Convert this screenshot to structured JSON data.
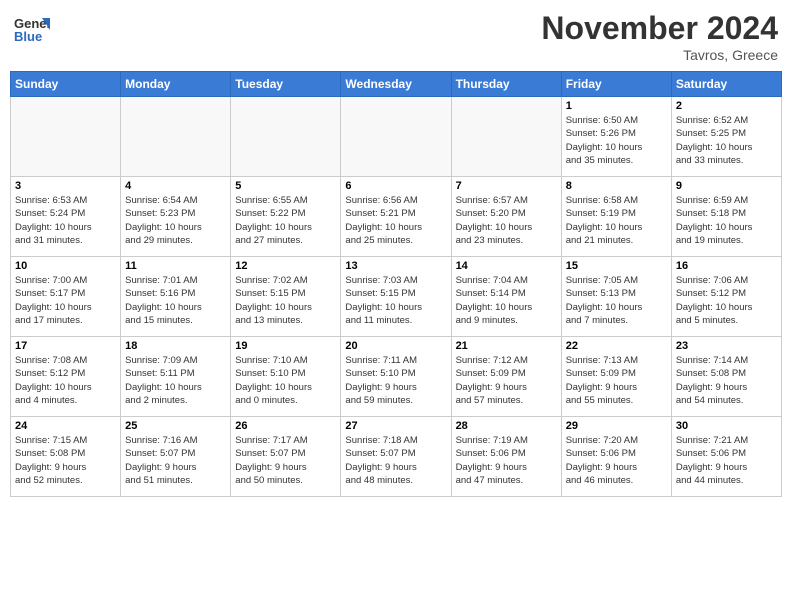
{
  "header": {
    "logo_general": "General",
    "logo_blue": "Blue",
    "month_title": "November 2024",
    "location": "Tavros, Greece"
  },
  "days_of_week": [
    "Sunday",
    "Monday",
    "Tuesday",
    "Wednesday",
    "Thursday",
    "Friday",
    "Saturday"
  ],
  "weeks": [
    [
      {
        "day": "",
        "info": ""
      },
      {
        "day": "",
        "info": ""
      },
      {
        "day": "",
        "info": ""
      },
      {
        "day": "",
        "info": ""
      },
      {
        "day": "",
        "info": ""
      },
      {
        "day": "1",
        "info": "Sunrise: 6:50 AM\nSunset: 5:26 PM\nDaylight: 10 hours\nand 35 minutes."
      },
      {
        "day": "2",
        "info": "Sunrise: 6:52 AM\nSunset: 5:25 PM\nDaylight: 10 hours\nand 33 minutes."
      }
    ],
    [
      {
        "day": "3",
        "info": "Sunrise: 6:53 AM\nSunset: 5:24 PM\nDaylight: 10 hours\nand 31 minutes."
      },
      {
        "day": "4",
        "info": "Sunrise: 6:54 AM\nSunset: 5:23 PM\nDaylight: 10 hours\nand 29 minutes."
      },
      {
        "day": "5",
        "info": "Sunrise: 6:55 AM\nSunset: 5:22 PM\nDaylight: 10 hours\nand 27 minutes."
      },
      {
        "day": "6",
        "info": "Sunrise: 6:56 AM\nSunset: 5:21 PM\nDaylight: 10 hours\nand 25 minutes."
      },
      {
        "day": "7",
        "info": "Sunrise: 6:57 AM\nSunset: 5:20 PM\nDaylight: 10 hours\nand 23 minutes."
      },
      {
        "day": "8",
        "info": "Sunrise: 6:58 AM\nSunset: 5:19 PM\nDaylight: 10 hours\nand 21 minutes."
      },
      {
        "day": "9",
        "info": "Sunrise: 6:59 AM\nSunset: 5:18 PM\nDaylight: 10 hours\nand 19 minutes."
      }
    ],
    [
      {
        "day": "10",
        "info": "Sunrise: 7:00 AM\nSunset: 5:17 PM\nDaylight: 10 hours\nand 17 minutes."
      },
      {
        "day": "11",
        "info": "Sunrise: 7:01 AM\nSunset: 5:16 PM\nDaylight: 10 hours\nand 15 minutes."
      },
      {
        "day": "12",
        "info": "Sunrise: 7:02 AM\nSunset: 5:15 PM\nDaylight: 10 hours\nand 13 minutes."
      },
      {
        "day": "13",
        "info": "Sunrise: 7:03 AM\nSunset: 5:15 PM\nDaylight: 10 hours\nand 11 minutes."
      },
      {
        "day": "14",
        "info": "Sunrise: 7:04 AM\nSunset: 5:14 PM\nDaylight: 10 hours\nand 9 minutes."
      },
      {
        "day": "15",
        "info": "Sunrise: 7:05 AM\nSunset: 5:13 PM\nDaylight: 10 hours\nand 7 minutes."
      },
      {
        "day": "16",
        "info": "Sunrise: 7:06 AM\nSunset: 5:12 PM\nDaylight: 10 hours\nand 5 minutes."
      }
    ],
    [
      {
        "day": "17",
        "info": "Sunrise: 7:08 AM\nSunset: 5:12 PM\nDaylight: 10 hours\nand 4 minutes."
      },
      {
        "day": "18",
        "info": "Sunrise: 7:09 AM\nSunset: 5:11 PM\nDaylight: 10 hours\nand 2 minutes."
      },
      {
        "day": "19",
        "info": "Sunrise: 7:10 AM\nSunset: 5:10 PM\nDaylight: 10 hours\nand 0 minutes."
      },
      {
        "day": "20",
        "info": "Sunrise: 7:11 AM\nSunset: 5:10 PM\nDaylight: 9 hours\nand 59 minutes."
      },
      {
        "day": "21",
        "info": "Sunrise: 7:12 AM\nSunset: 5:09 PM\nDaylight: 9 hours\nand 57 minutes."
      },
      {
        "day": "22",
        "info": "Sunrise: 7:13 AM\nSunset: 5:09 PM\nDaylight: 9 hours\nand 55 minutes."
      },
      {
        "day": "23",
        "info": "Sunrise: 7:14 AM\nSunset: 5:08 PM\nDaylight: 9 hours\nand 54 minutes."
      }
    ],
    [
      {
        "day": "24",
        "info": "Sunrise: 7:15 AM\nSunset: 5:08 PM\nDaylight: 9 hours\nand 52 minutes."
      },
      {
        "day": "25",
        "info": "Sunrise: 7:16 AM\nSunset: 5:07 PM\nDaylight: 9 hours\nand 51 minutes."
      },
      {
        "day": "26",
        "info": "Sunrise: 7:17 AM\nSunset: 5:07 PM\nDaylight: 9 hours\nand 50 minutes."
      },
      {
        "day": "27",
        "info": "Sunrise: 7:18 AM\nSunset: 5:07 PM\nDaylight: 9 hours\nand 48 minutes."
      },
      {
        "day": "28",
        "info": "Sunrise: 7:19 AM\nSunset: 5:06 PM\nDaylight: 9 hours\nand 47 minutes."
      },
      {
        "day": "29",
        "info": "Sunrise: 7:20 AM\nSunset: 5:06 PM\nDaylight: 9 hours\nand 46 minutes."
      },
      {
        "day": "30",
        "info": "Sunrise: 7:21 AM\nSunset: 5:06 PM\nDaylight: 9 hours\nand 44 minutes."
      }
    ]
  ]
}
